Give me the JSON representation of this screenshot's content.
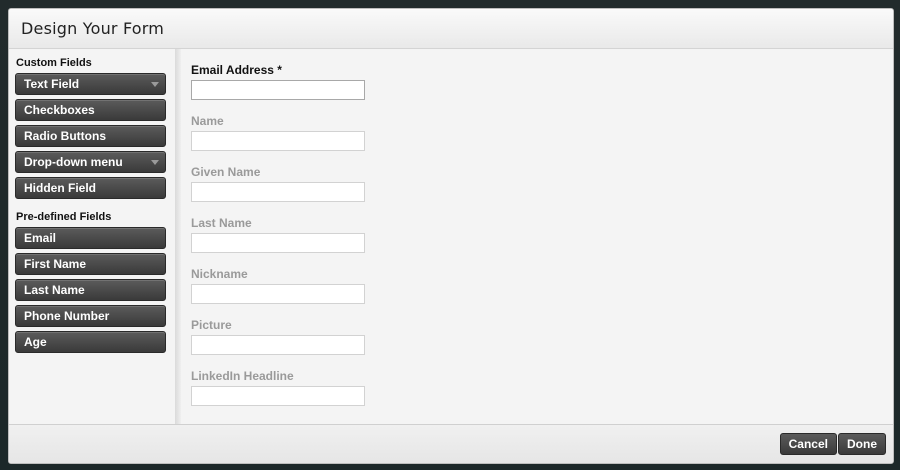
{
  "modal": {
    "title": "Design Your Form"
  },
  "sidebar": {
    "custom_title": "Custom Fields",
    "custom_fields": [
      {
        "label": "Text Field",
        "has_dropdown": true
      },
      {
        "label": "Checkboxes",
        "has_dropdown": false
      },
      {
        "label": "Radio Buttons",
        "has_dropdown": false
      },
      {
        "label": "Drop-down menu",
        "has_dropdown": true
      },
      {
        "label": "Hidden Field",
        "has_dropdown": false
      }
    ],
    "predefined_title": "Pre-defined Fields",
    "predefined_fields": [
      {
        "label": "Email"
      },
      {
        "label": "First Name"
      },
      {
        "label": "Last Name"
      },
      {
        "label": "Phone Number"
      },
      {
        "label": "Age"
      }
    ]
  },
  "form": {
    "fields": [
      {
        "label": "Email Address *",
        "value": "",
        "active": true
      },
      {
        "label": "Name",
        "value": "",
        "active": false
      },
      {
        "label": "Given Name",
        "value": "",
        "active": false
      },
      {
        "label": "Last Name",
        "value": "",
        "active": false
      },
      {
        "label": "Nickname",
        "value": "",
        "active": false
      },
      {
        "label": "Picture",
        "value": "",
        "active": false
      },
      {
        "label": "LinkedIn Headline",
        "value": "",
        "active": false
      }
    ]
  },
  "footer": {
    "cancel_label": "Cancel",
    "done_label": "Done"
  },
  "colors": {
    "button_dark": "#3a3a3a",
    "panel_bg": "#f4f4f4",
    "inactive_label": "#9a9a9a"
  }
}
